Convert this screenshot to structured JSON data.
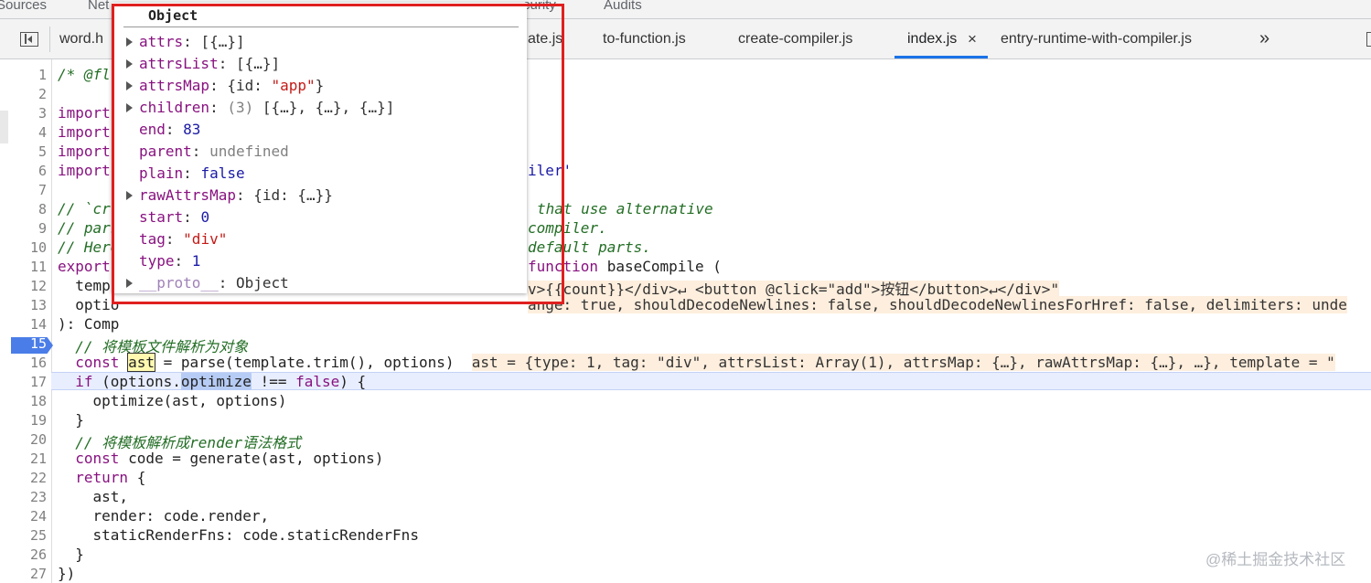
{
  "top_tabs": [
    "Sources",
    "Net",
    "curity",
    "Audits"
  ],
  "file_tabs": [
    "word.h",
    "ate.js",
    "to-function.js",
    "create-compiler.js",
    "index.js",
    "entry-runtime-with-compiler.js"
  ],
  "icons": {
    "nav_toggle": "sidebar-toggle-icon",
    "close": "close-icon",
    "more": "chevron-double-right-icon"
  },
  "close_glyph": "×",
  "more_glyph": "»",
  "breakpoint_line": "15",
  "line_numbers": [
    "1",
    "2",
    "3",
    "4",
    "5",
    "6",
    "7",
    "8",
    "9",
    "10",
    "11",
    "12",
    "13",
    "14",
    "15",
    "16",
    "17",
    "18",
    "19",
    "20",
    "21",
    "22",
    "23",
    "24",
    "25",
    "26",
    "27"
  ],
  "code": {
    "l1": "/* @fl",
    "l3": "import",
    "l4": "import",
    "l5": "import",
    "l6": "import",
    "l6_tail": "iler'",
    "l8_a": "// `cr",
    "l8_b": "that use alternative",
    "l9_a": "// pars",
    "l9_b": "compiler.",
    "l10_a": "// Here",
    "l10_b": "default parts.",
    "l11_a": "export",
    "l11_b": "function baseCompile (",
    "l12_a": "  templ",
    "l12_b": "v>{{count}}</div>↵ <button @click=\"add\">按钮</button>↵</div>\"",
    "l13_a": "  optio",
    "l13_b": "ange: true, shouldDecodeNewlines: false, shouldDecodeNewlinesForHref: false, delimiters: unde",
    "l14": "): Comp",
    "l15": "  // 将模板文件解析为对象",
    "l16_const": "const",
    "l16_var": "ast",
    "l16_rest": " = parse(template.trim(), options)",
    "l16_inline": "ast = {type: 1, tag: \"div\", attrsList: Array(1), attrsMap: {…}, rawAttrsMap: {…}, …}, template = \"",
    "l17_if": "if",
    "l17_a": " (options.",
    "l17_sel": "optimize",
    "l17_b": " !== ",
    "l17_false": "false",
    "l17_c": ") {",
    "l18": "    optimize(ast, options)",
    "l19": "  }",
    "l20": "  // 将模板解析成render语法格式",
    "l21_const": "const",
    "l21_rest": " code = generate(ast, options)",
    "l22_return": "return",
    "l22_rest": " {",
    "l23": "    ast,",
    "l24": "    render: code.render,",
    "l25": "    staticRenderFns: code.staticRenderFns",
    "l26": "  }",
    "l27": "})"
  },
  "popover": {
    "title": "Object",
    "props": [
      {
        "key": "attrs",
        "val": "[{…}]",
        "vtype": "p",
        "expand": true
      },
      {
        "key": "attrsList",
        "val": "[{…}]",
        "vtype": "p",
        "expand": true
      },
      {
        "key": "attrsMap",
        "val": "{id: ",
        "val2": "\"app\"",
        "val3": "}",
        "vtype": "mix",
        "expand": true
      },
      {
        "key": "children",
        "val": "(3) ",
        "val2": "[{…}, {…}, {…}]",
        "vtype": "gp",
        "expand": true
      },
      {
        "key": "end",
        "val": "83",
        "vtype": "n",
        "expand": false
      },
      {
        "key": "parent",
        "val": "undefined",
        "vtype": "g",
        "expand": false
      },
      {
        "key": "plain",
        "val": "false",
        "vtype": "n",
        "expand": false
      },
      {
        "key": "rawAttrsMap",
        "val": "{id: {…}}",
        "vtype": "p",
        "expand": true
      },
      {
        "key": "start",
        "val": "0",
        "vtype": "n",
        "expand": false
      },
      {
        "key": "tag",
        "val": "\"div\"",
        "vtype": "s",
        "expand": false
      },
      {
        "key": "type",
        "val": "1",
        "vtype": "n",
        "expand": false
      },
      {
        "key": "__proto__",
        "val": "Object",
        "vtype": "p",
        "expand": true,
        "proto": true
      }
    ]
  },
  "watermark": "@稀土掘金技术社区",
  "colors": {
    "accent": "#1a73e8",
    "highlight_frame": "#e02020",
    "breakpoint": "#4a7de8"
  }
}
